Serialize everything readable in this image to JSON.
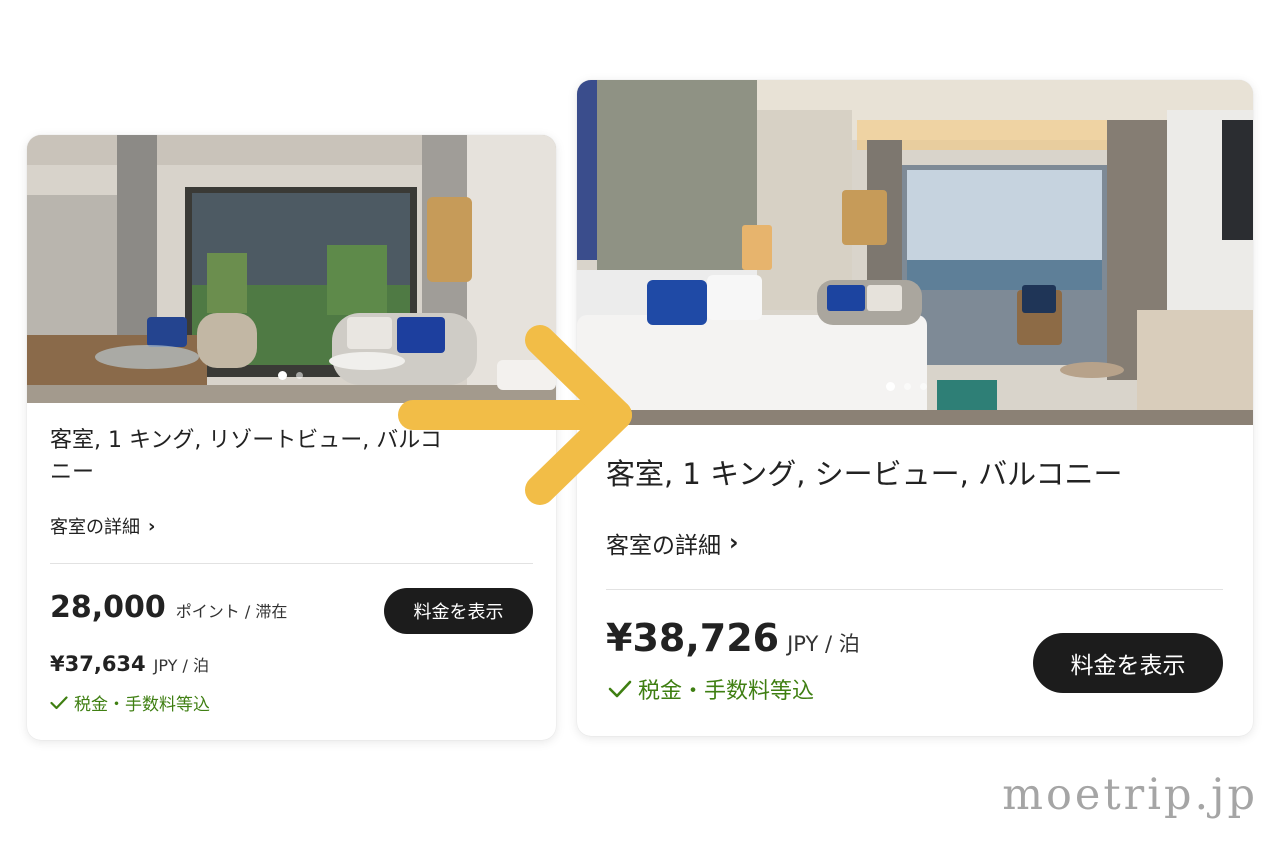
{
  "cards": [
    {
      "title": "客室, 1 キング, リゾートビュー, バルコニー",
      "details_link": "客室の詳細",
      "points": {
        "amount": "28,000",
        "unit": "ポイント / 滞在"
      },
      "price": {
        "amount": "¥37,634",
        "unit": "JPY / 泊"
      },
      "tax_note": "税金・手数料等込",
      "button_label": "料金を表示",
      "carousel": {
        "count": 2,
        "active_index": 0
      }
    },
    {
      "title": "客室, 1 キング, シービュー, バルコニー",
      "details_link": "客室の詳細",
      "price": {
        "amount": "¥38,726",
        "unit": "JPY / 泊"
      },
      "tax_note": "税金・手数料等込",
      "button_label": "料金を表示",
      "carousel": {
        "count": 3,
        "active_index": 0
      }
    }
  ],
  "watermark": "moetrip.jp",
  "colors": {
    "arrow": "#f2bd47",
    "tax_green": "#3f7f12",
    "button_bg": "#1c1c1c",
    "watermark": "#a5a5a5"
  },
  "icons": {
    "chevron": "chevron-right-icon",
    "check": "checkmark-icon",
    "arrow": "arrow-right-icon"
  }
}
